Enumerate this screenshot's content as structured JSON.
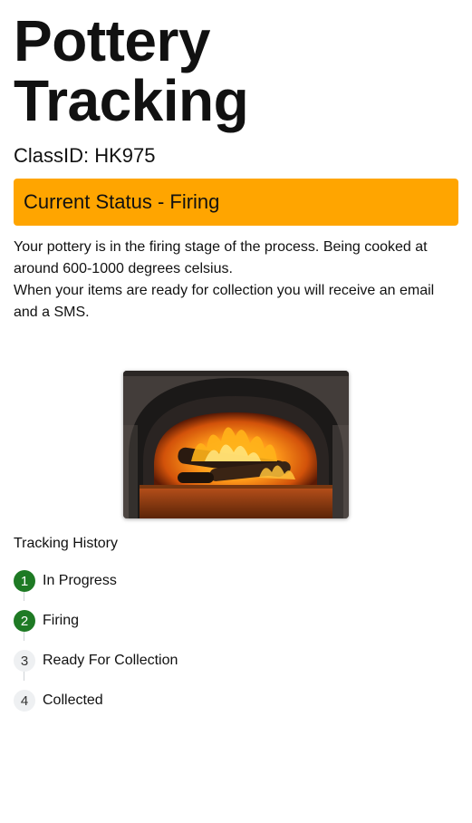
{
  "header": {
    "title": "Pottery Tracking"
  },
  "class": {
    "id_label": "ClassID: HK975"
  },
  "status": {
    "banner_text": "Current Status - Firing",
    "banner_color": "#FFA500",
    "description_1": "Your pottery is in the firing stage of the process. Being cooked at around 600-1000 degrees celsius.",
    "description_2": "When your items are ready for collection you will receive an email and a SMS."
  },
  "image": {
    "subject": "wood-fired-oven-flames"
  },
  "history": {
    "title": "Tracking History",
    "steps": [
      {
        "number": "1",
        "label": "In Progress",
        "completed": true
      },
      {
        "number": "2",
        "label": "Firing",
        "completed": true
      },
      {
        "number": "3",
        "label": "Ready For Collection",
        "completed": false
      },
      {
        "number": "4",
        "label": "Collected",
        "completed": false
      }
    ],
    "completed_color": "#1E7A24"
  }
}
